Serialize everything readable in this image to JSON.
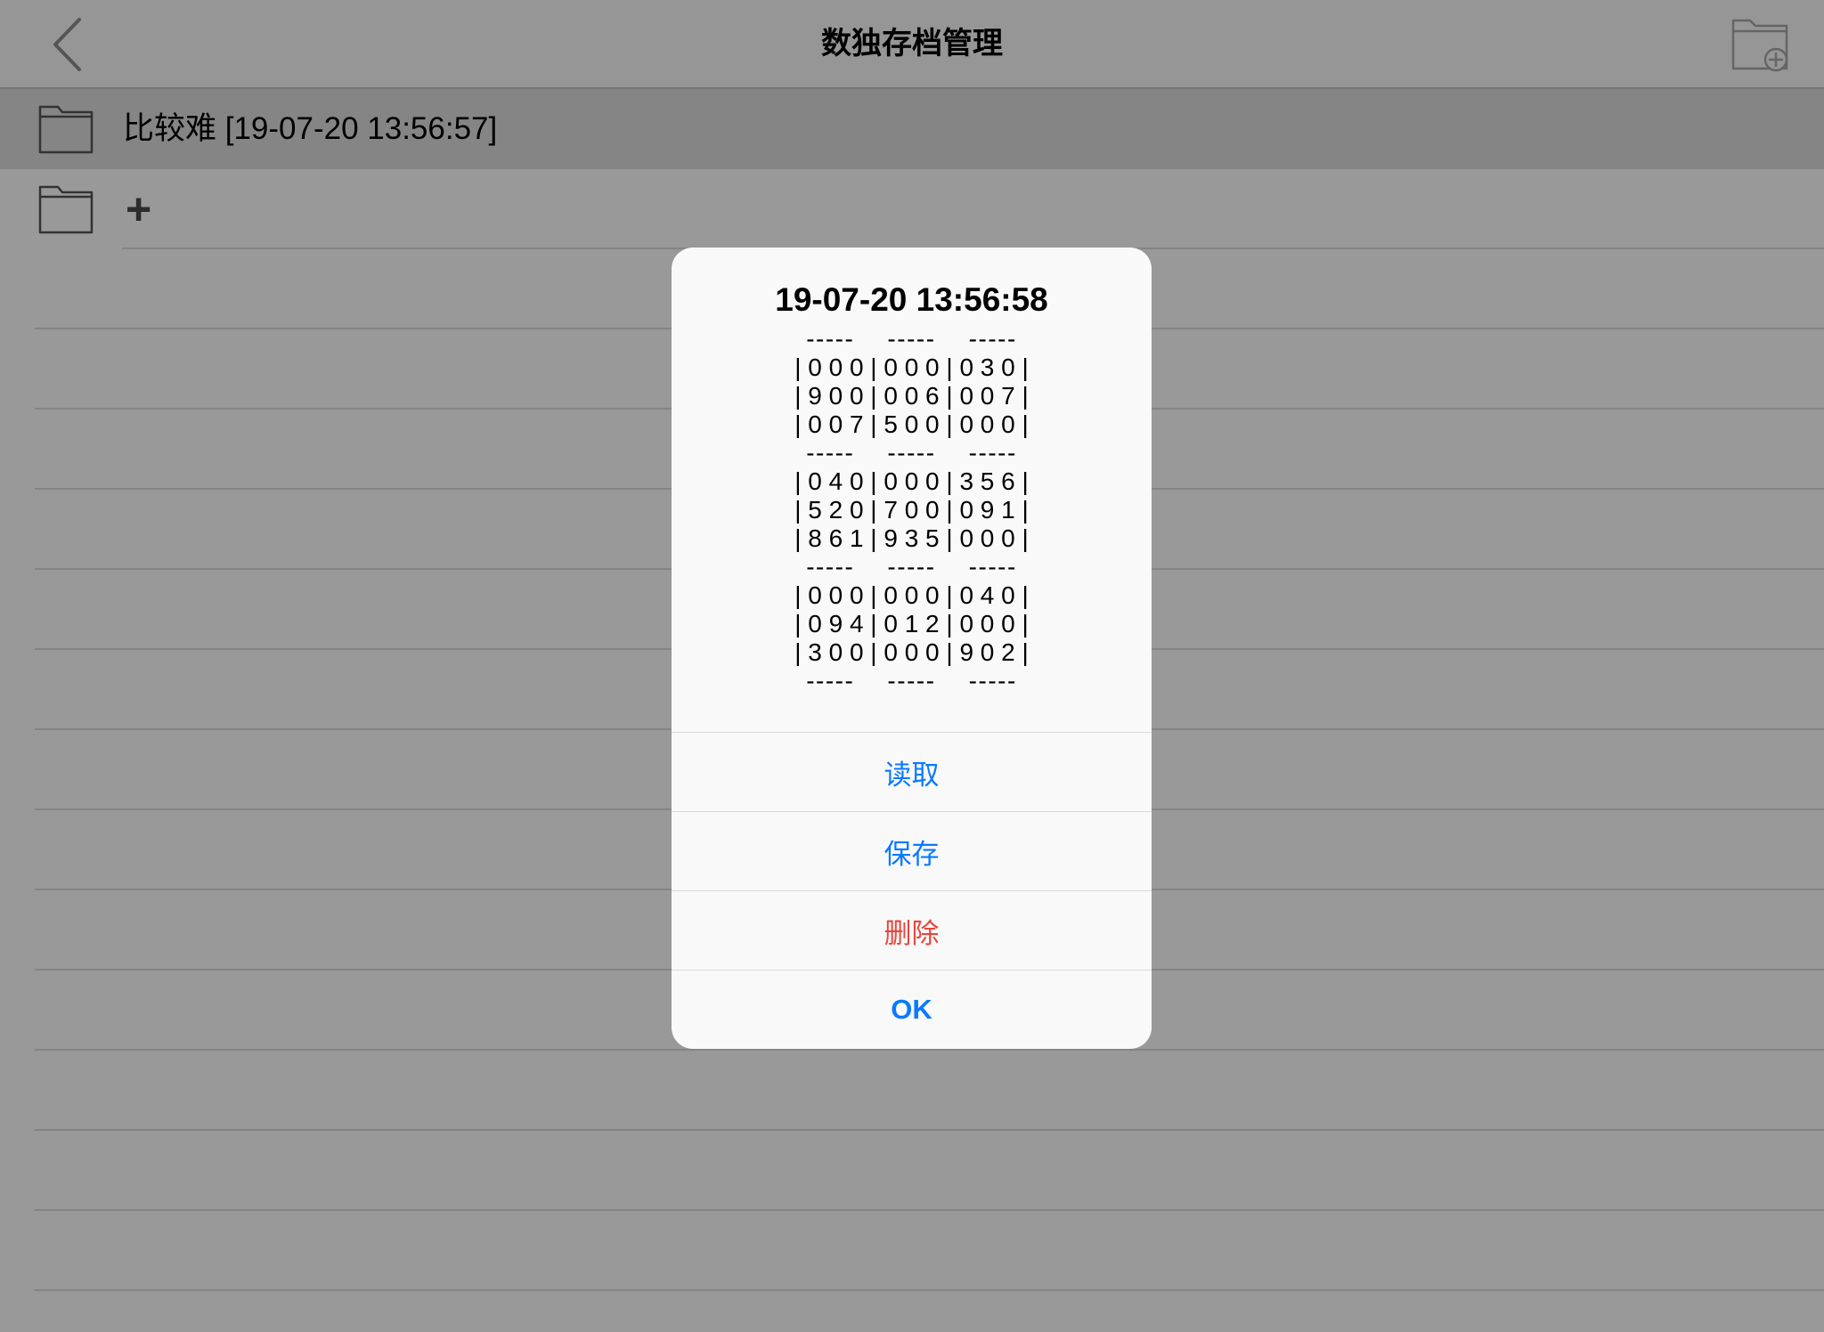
{
  "nav": {
    "title": "数独存档管理",
    "back_icon": "chevron-left-icon",
    "add_folder_icon": "folder-add-icon"
  },
  "saves": {
    "items": [
      {
        "icon": "folder-icon",
        "label": "比较难 [19-07-20 13:56:57]",
        "selected": true
      },
      {
        "icon": "folder-icon",
        "label": "+",
        "selected": false
      }
    ]
  },
  "dialog": {
    "title": "19-07-20 13:56:58",
    "message_lines": [
      "-----    -----    -----",
      "| 0 0 0 | 0 0 0 | 0 3 0 |",
      "| 9 0 0 | 0 0 6 | 0 0 7 |",
      "| 0 0 7 | 5 0 0 | 0 0 0 |",
      "-----    -----    -----",
      "| 0 4 0 | 0 0 0 | 3 5 6 |",
      "| 5 2 0 | 7 0 0 | 0 9 1 |",
      "| 8 6 1 | 9 3 5 | 0 0 0 |",
      "-----    -----    -----",
      "| 0 0 0 | 0 0 0 | 0 4 0 |",
      "| 0 9 4 | 0 1 2 | 0 0 0 |",
      "| 3 0 0 | 0 0 0 | 9 0 2 |",
      "-----    -----    -----"
    ],
    "buttons": [
      {
        "label": "读取"
      },
      {
        "label": "保存"
      },
      {
        "label": "删除"
      },
      {
        "label": "OK"
      }
    ]
  },
  "colors": {
    "accent": "#0a7aff",
    "destructive": "#e9463c"
  }
}
